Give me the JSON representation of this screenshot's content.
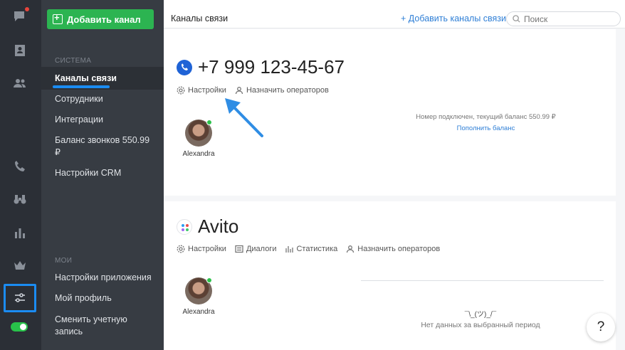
{
  "rail": {
    "icons": [
      "chat-icon",
      "contacts-card-icon",
      "people-icon",
      "phone-icon",
      "binoculars-icon",
      "bar-chart-icon",
      "crown-icon",
      "sliders-icon"
    ]
  },
  "nav": {
    "add_channel_label": "Добавить канал",
    "system_section": "СИСТЕМА",
    "system_items": [
      "Каналы связи",
      "Сотрудники",
      "Интеграции",
      "Баланс звонков 550.99 ₽",
      "Настройки CRM"
    ],
    "my_section": "МОИ",
    "my_items": [
      "Настройки приложения",
      "Мой профиль",
      "Сменить учетную запись"
    ]
  },
  "header": {
    "title": "Каналы связи",
    "add_link": "+ Добавить каналы связи",
    "search_placeholder": "Поиск"
  },
  "channels": [
    {
      "title": "+7 999 123-45-67",
      "actions": [
        "Настройки",
        "Назначить операторов"
      ],
      "operator": "Alexandra",
      "balance_text": "Номер подключен, текущий баланс 550.99 ₽",
      "balance_link": "Пополнить баланс"
    },
    {
      "title": "Avito",
      "actions": [
        "Настройки",
        "Диалоги",
        "Статистика",
        "Назначить операторов"
      ],
      "operator": "Alexandra",
      "nodata_face": "¯\\_(ツ)_/¯",
      "nodata_text": "Нет данных за выбранный период"
    }
  ],
  "help_label": "?",
  "colors": {
    "accent": "#1b8cf2",
    "green": "#2cb451",
    "sidebar": "#373c43",
    "rail": "#2b2f36"
  }
}
